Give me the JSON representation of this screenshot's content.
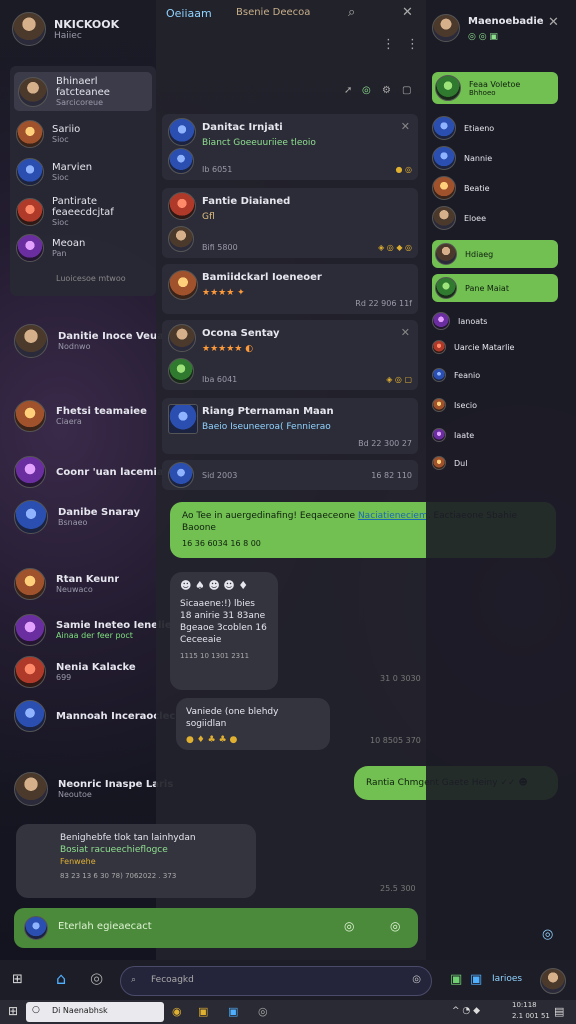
{
  "header": {
    "name": "NKICKOOK",
    "status": "Haiiec"
  },
  "dropdown": {
    "selected": {
      "name": "Bhinaerl fatcteanee",
      "sub": "Sarcicoreue"
    },
    "items": [
      {
        "name": "Sariio",
        "sub": "Sioc"
      },
      {
        "name": "Marvien",
        "sub": "Sioc"
      },
      {
        "name": "Pantirate feaeecdcjtaf",
        "sub": "Sioc"
      },
      {
        "name": "Meoan",
        "sub": "Pan"
      }
    ],
    "footer": "Luoicesoe mtwoo"
  },
  "left_chats": [
    {
      "name": "Danitie Inoce Veuae",
      "sub": "Nodnwo"
    },
    {
      "name": "Fhetsi teamaiee",
      "sub": "Ciaera"
    },
    {
      "name": "Coonr 'uan lacemiaer",
      "sub": ""
    },
    {
      "name": "Danibe Snaray",
      "sub": "Bsnaeo"
    },
    {
      "name": "Rtan Keunr",
      "sub": "Neuwaco"
    },
    {
      "name": "Samie Ineteo Ienelie",
      "sub": "Ainaa der feer poct"
    },
    {
      "name": "Nenia Kalacke",
      "sub": "699"
    },
    {
      "name": "Mannoah Inceraoclec",
      "sub": ""
    },
    {
      "name": "Neonric Inaspe Laris",
      "sub": "Neoutoe"
    }
  ],
  "center": {
    "tab_active": "Oeiiaam",
    "tab_other": "Bsenie Deecoa",
    "cards": [
      {
        "title": "Danitac Irnjati",
        "sub": "Bianct  Goeeuuriiee tleoio",
        "ts": "Ib  6051",
        "ts2": "Ib  6051"
      },
      {
        "title": "Fantie Diaianed",
        "sub": "Gfl",
        "ts": "Bifi  5800",
        "ts2": "Bifi  5800"
      },
      {
        "title": "Bamiidckarl Ioeneoer",
        "sub": "",
        "ts": "Rd   22 906 11f",
        "ts2": ""
      },
      {
        "title": "Ocona Sentay",
        "sub": "",
        "ts": "Iba  6041",
        "ts2": ""
      },
      {
        "title": "Riang Pternaman Maan",
        "sub": "Baeio Iseuneeroa( Fennierao",
        "ts": "Bd   22 300 27",
        "ts2": ""
      },
      {
        "title": "",
        "sub": "",
        "ts": "Sid  2003",
        "ts2": "16 82 110"
      }
    ],
    "messages": [
      {
        "text": "Ao Tee in auergedinafing! Eeqaeceone ",
        "link": "Naciatieneciem",
        "rest": ". Eactiaeone Sbahie Baoone",
        "ts": "16 36 6034 16 8 00",
        "side": "right"
      },
      {
        "text": "Sicaaene:!) lbies 18 anirie 31 83ane Bgeaoe 3coblen 16 Ceceeaie",
        "ts": "1115  10   1301 2311",
        "ts_side": "31 0 3030",
        "side": "left"
      },
      {
        "text": "Vaniede (one blehdy sogiidlan",
        "ts_side": "10 8505 370",
        "side": "left"
      },
      {
        "text": "Rantia Chmgent Gaete Heiny  ",
        "side": "right"
      },
      {
        "text": "Benighebfe tlok tan lainhydan",
        "text2": "Bosiat racueechieflogce",
        "sub": "Fenwehe",
        "ts": "83  23 13 6 30 78)   7062022 . 373",
        "ts_side": "25.5 300",
        "side": "left"
      }
    ],
    "compose": {
      "placeholder": "Eterlah egieaecact"
    }
  },
  "right": {
    "title": "Maenoebadie",
    "items": [
      {
        "name": "Feaa Voletoe",
        "sub": "Bhhoeo",
        "hl": true
      },
      {
        "name": "Etiaeno",
        "sub": ""
      },
      {
        "name": "Nannie",
        "sub": ""
      },
      {
        "name": "Beatie",
        "sub": ""
      },
      {
        "name": "Eloee",
        "sub": ""
      },
      {
        "name": "Hdiaeg",
        "sub": "",
        "hl": true
      },
      {
        "name": "Pane Maiat",
        "sub": "",
        "hl": true
      },
      {
        "name": "Ianoats",
        "sub": ""
      },
      {
        "name": "Uarcie Matarlie",
        "sub": ""
      },
      {
        "name": "Feanio",
        "sub": ""
      },
      {
        "name": "Isecio",
        "sub": ""
      },
      {
        "name": "Iaate",
        "sub": ""
      },
      {
        "name": "Dul",
        "sub": ""
      }
    ]
  },
  "taskbar": {
    "search_placeholder": "Fecoagkd",
    "app_label": "Iarioes",
    "start_label": "Di Naenabhsk",
    "clock": "10:118",
    "clock2": "2.1 001 51"
  }
}
